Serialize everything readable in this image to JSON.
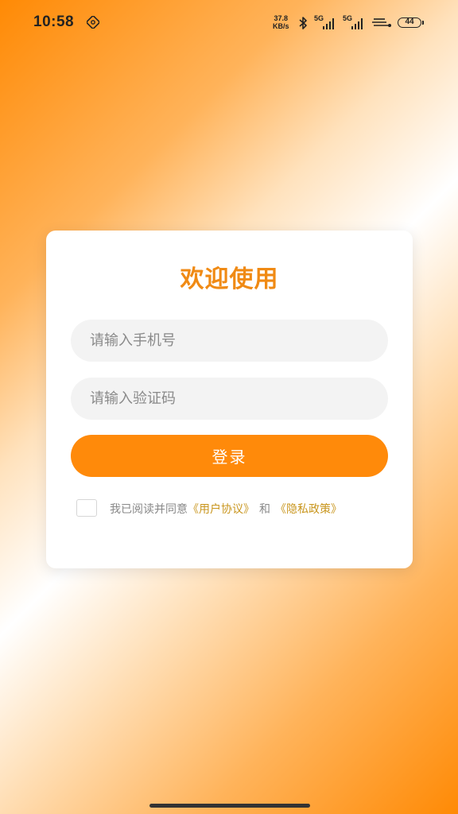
{
  "status_bar": {
    "time": "10:58",
    "net_speed_value": "37.8",
    "net_speed_unit": "KB/s",
    "signal1_label": "5G",
    "signal2_label": "5G",
    "battery": "44"
  },
  "login": {
    "title": "欢迎使用",
    "phone_placeholder": "请输入手机号",
    "code_placeholder": "请输入验证码",
    "login_label": "登录",
    "agree_prefix": "我已阅读并同意",
    "user_agreement": "《用户协议》",
    "and": "和",
    "privacy_policy": "《隐私政策》"
  },
  "colors": {
    "accent": "#ff8a0a",
    "title": "#f08a14",
    "link": "#c9961e"
  },
  "icons": [
    "nfc-icon",
    "bluetooth-icon",
    "signal-icon",
    "wifi-icon",
    "battery-icon"
  ]
}
